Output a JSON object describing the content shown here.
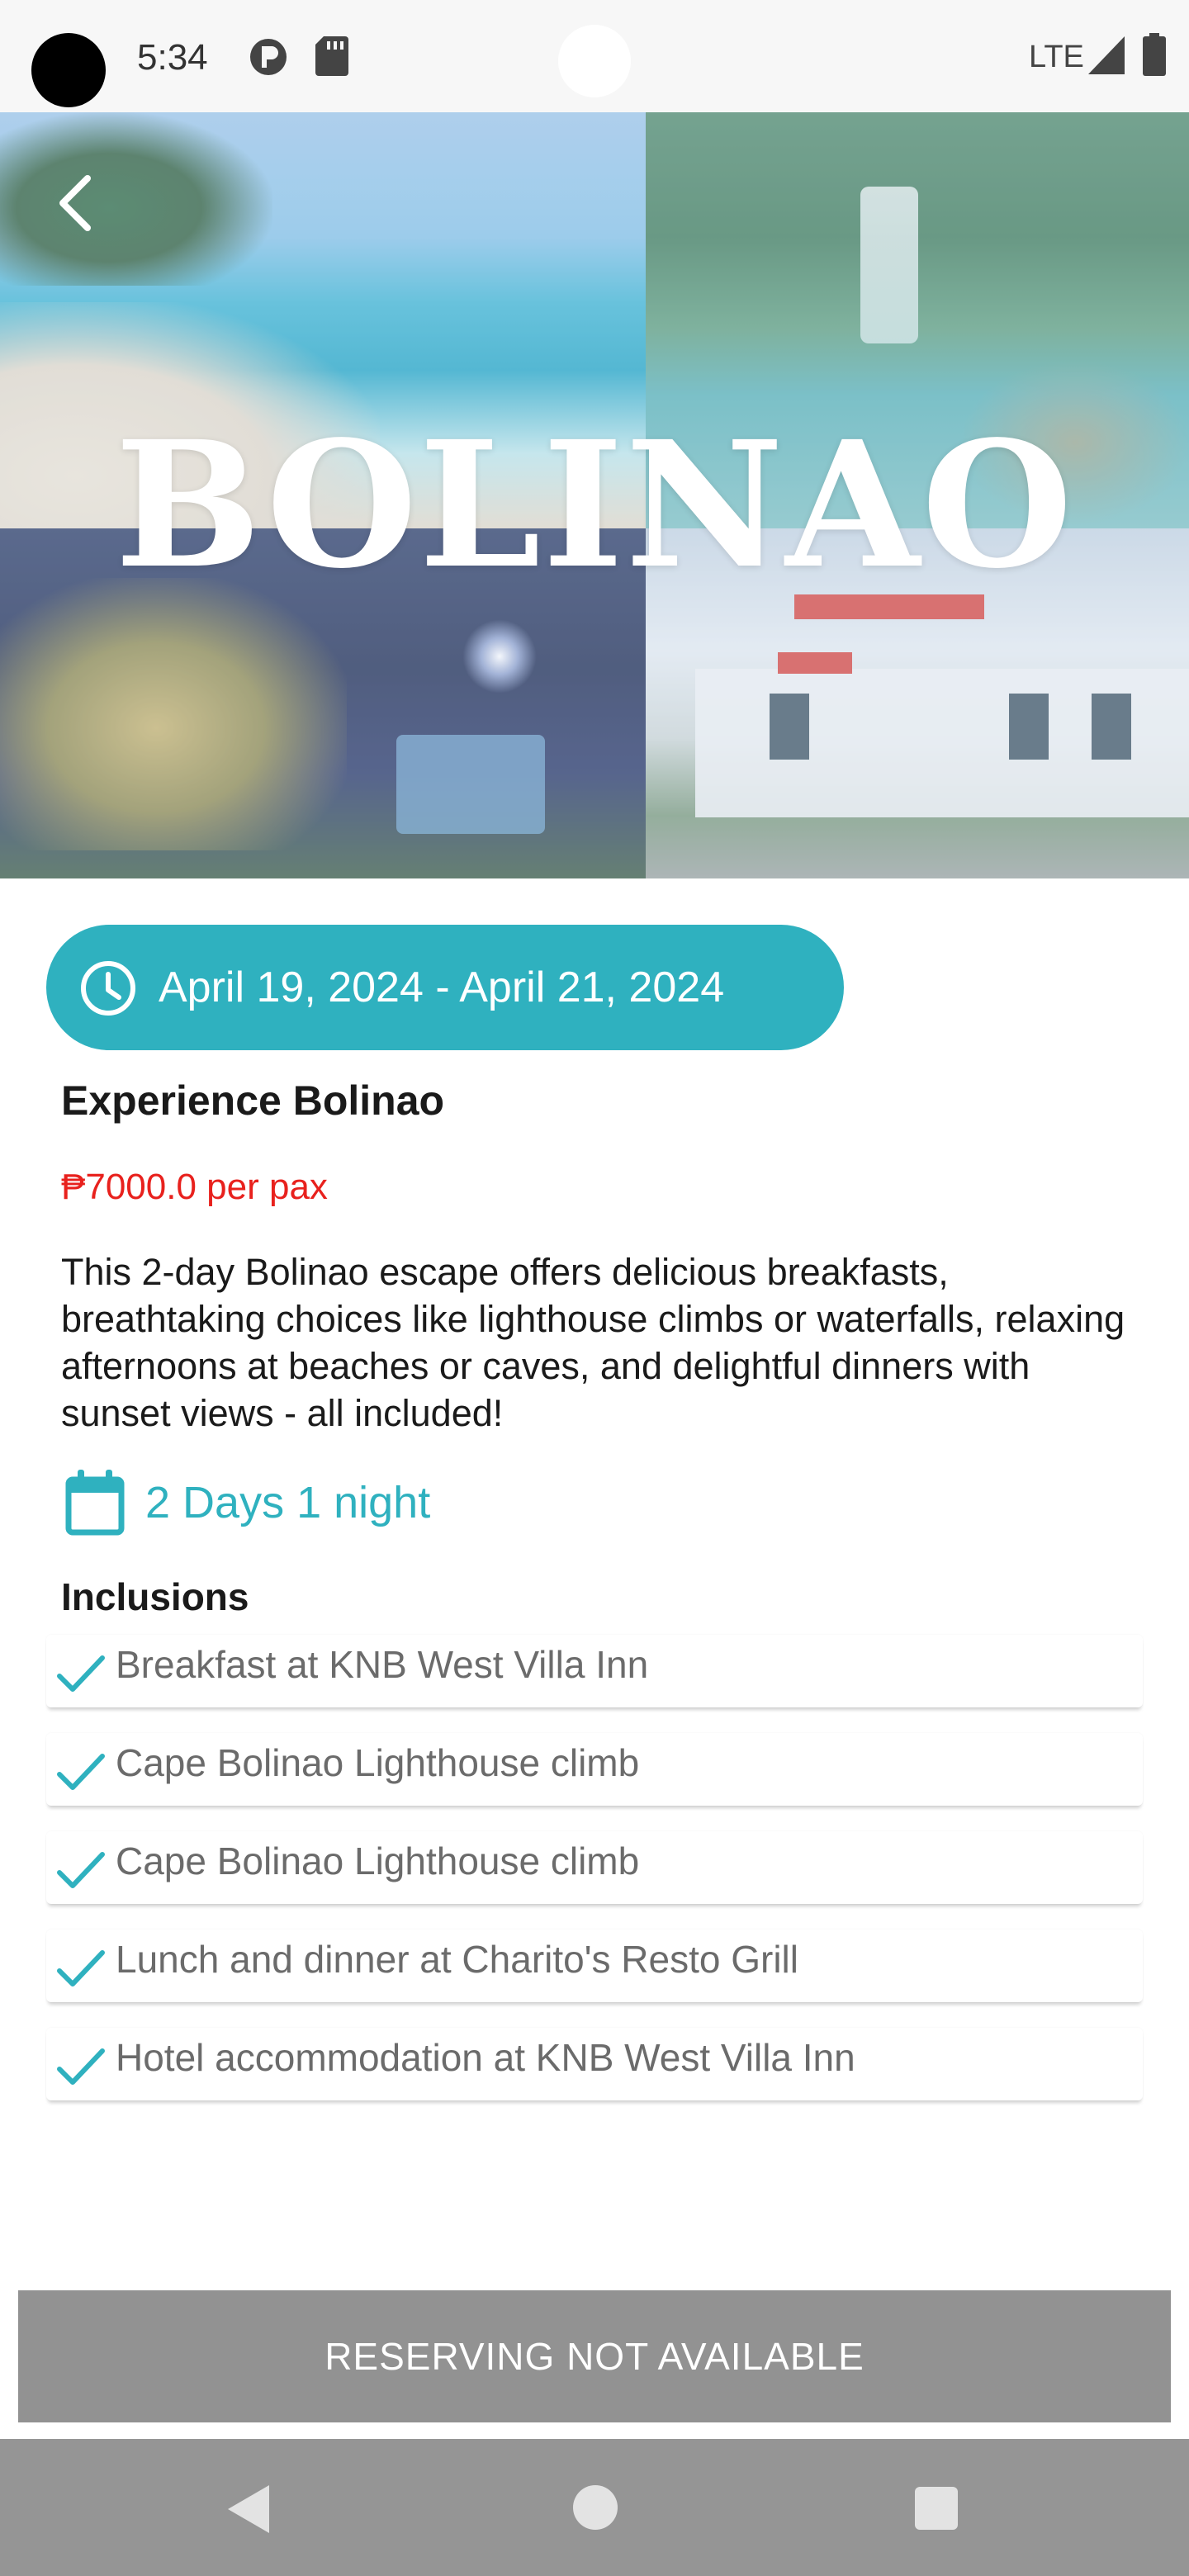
{
  "status_bar": {
    "time": "5:34",
    "network": "LTE",
    "icons": [
      "app-p-icon",
      "sd-card-icon",
      "signal-icon",
      "battery-icon"
    ]
  },
  "hero": {
    "title": "BOLINAO",
    "back_icon": "back-arrow-icon"
  },
  "trip": {
    "date_range": "April 19, 2024 - April 21, 2024",
    "title": "Experience Bolinao",
    "price": "₱7000.0 per pax",
    "description": "This 2-day Bolinao escape offers delicious breakfasts, breathtaking choices like lighthouse climbs or waterfalls, relaxing afternoons at beaches or caves, and delightful dinners with sunset views - all included!",
    "duration": "2 Days 1 night"
  },
  "inclusions": {
    "title": "Inclusions",
    "items": [
      "Breakfast at KNB West Villa Inn",
      "Cape Bolinao Lighthouse climb",
      "Cape Bolinao Lighthouse climb",
      "Lunch and dinner at Charito's Resto Grill",
      "Hotel accommodation at KNB West Villa Inn"
    ]
  },
  "actions": {
    "reserve_label": "RESERVING NOT AVAILABLE"
  },
  "colors": {
    "accent": "#2fb1bf",
    "price": "#e8211d",
    "disabled_button": "#929292"
  }
}
